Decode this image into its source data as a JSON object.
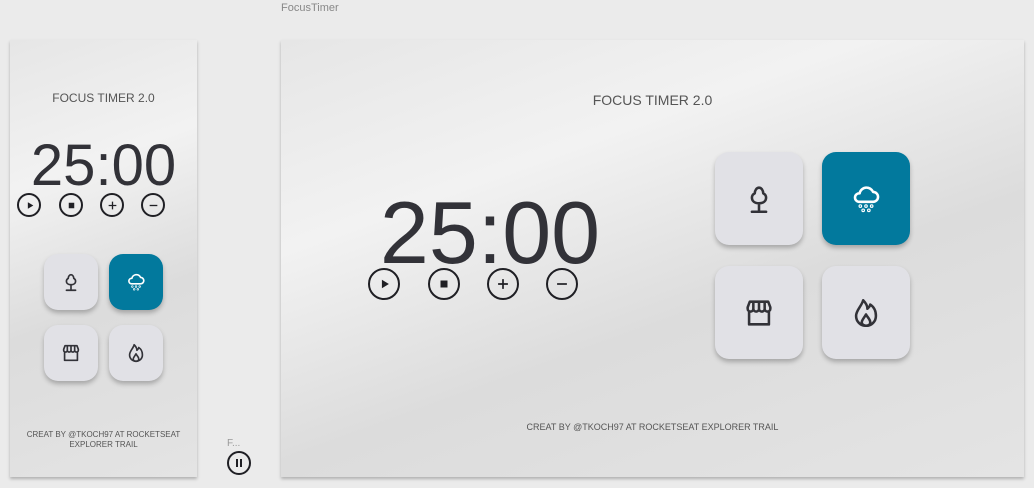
{
  "window_title": "FocusTimer",
  "minimized_label": "F...",
  "app": {
    "title": "FOCUS TIMER 2.0",
    "minutes": "25",
    "seconds": "00",
    "separator": ":",
    "credit_line1": "CREAT BY @TKOCH97 AT ROCKETSEAT",
    "credit_line2": "EXPLORER TRAIL",
    "credit": "CREAT BY @TKOCH97 AT ROCKETSEAT EXPLORER TRAIL"
  },
  "controls": [
    "play-icon",
    "stop-icon",
    "plus-icon",
    "minus-icon"
  ],
  "sounds": [
    {
      "name": "forest",
      "icon": "tree-icon",
      "active": false
    },
    {
      "name": "rain",
      "icon": "cloud-rain-icon",
      "active": true
    },
    {
      "name": "coffee-shop",
      "icon": "storefront-icon",
      "active": false
    },
    {
      "name": "fireplace",
      "icon": "fire-icon",
      "active": false
    }
  ],
  "colors": {
    "accent": "#02799d",
    "text": "#323238",
    "card": "#e1e1e6"
  }
}
